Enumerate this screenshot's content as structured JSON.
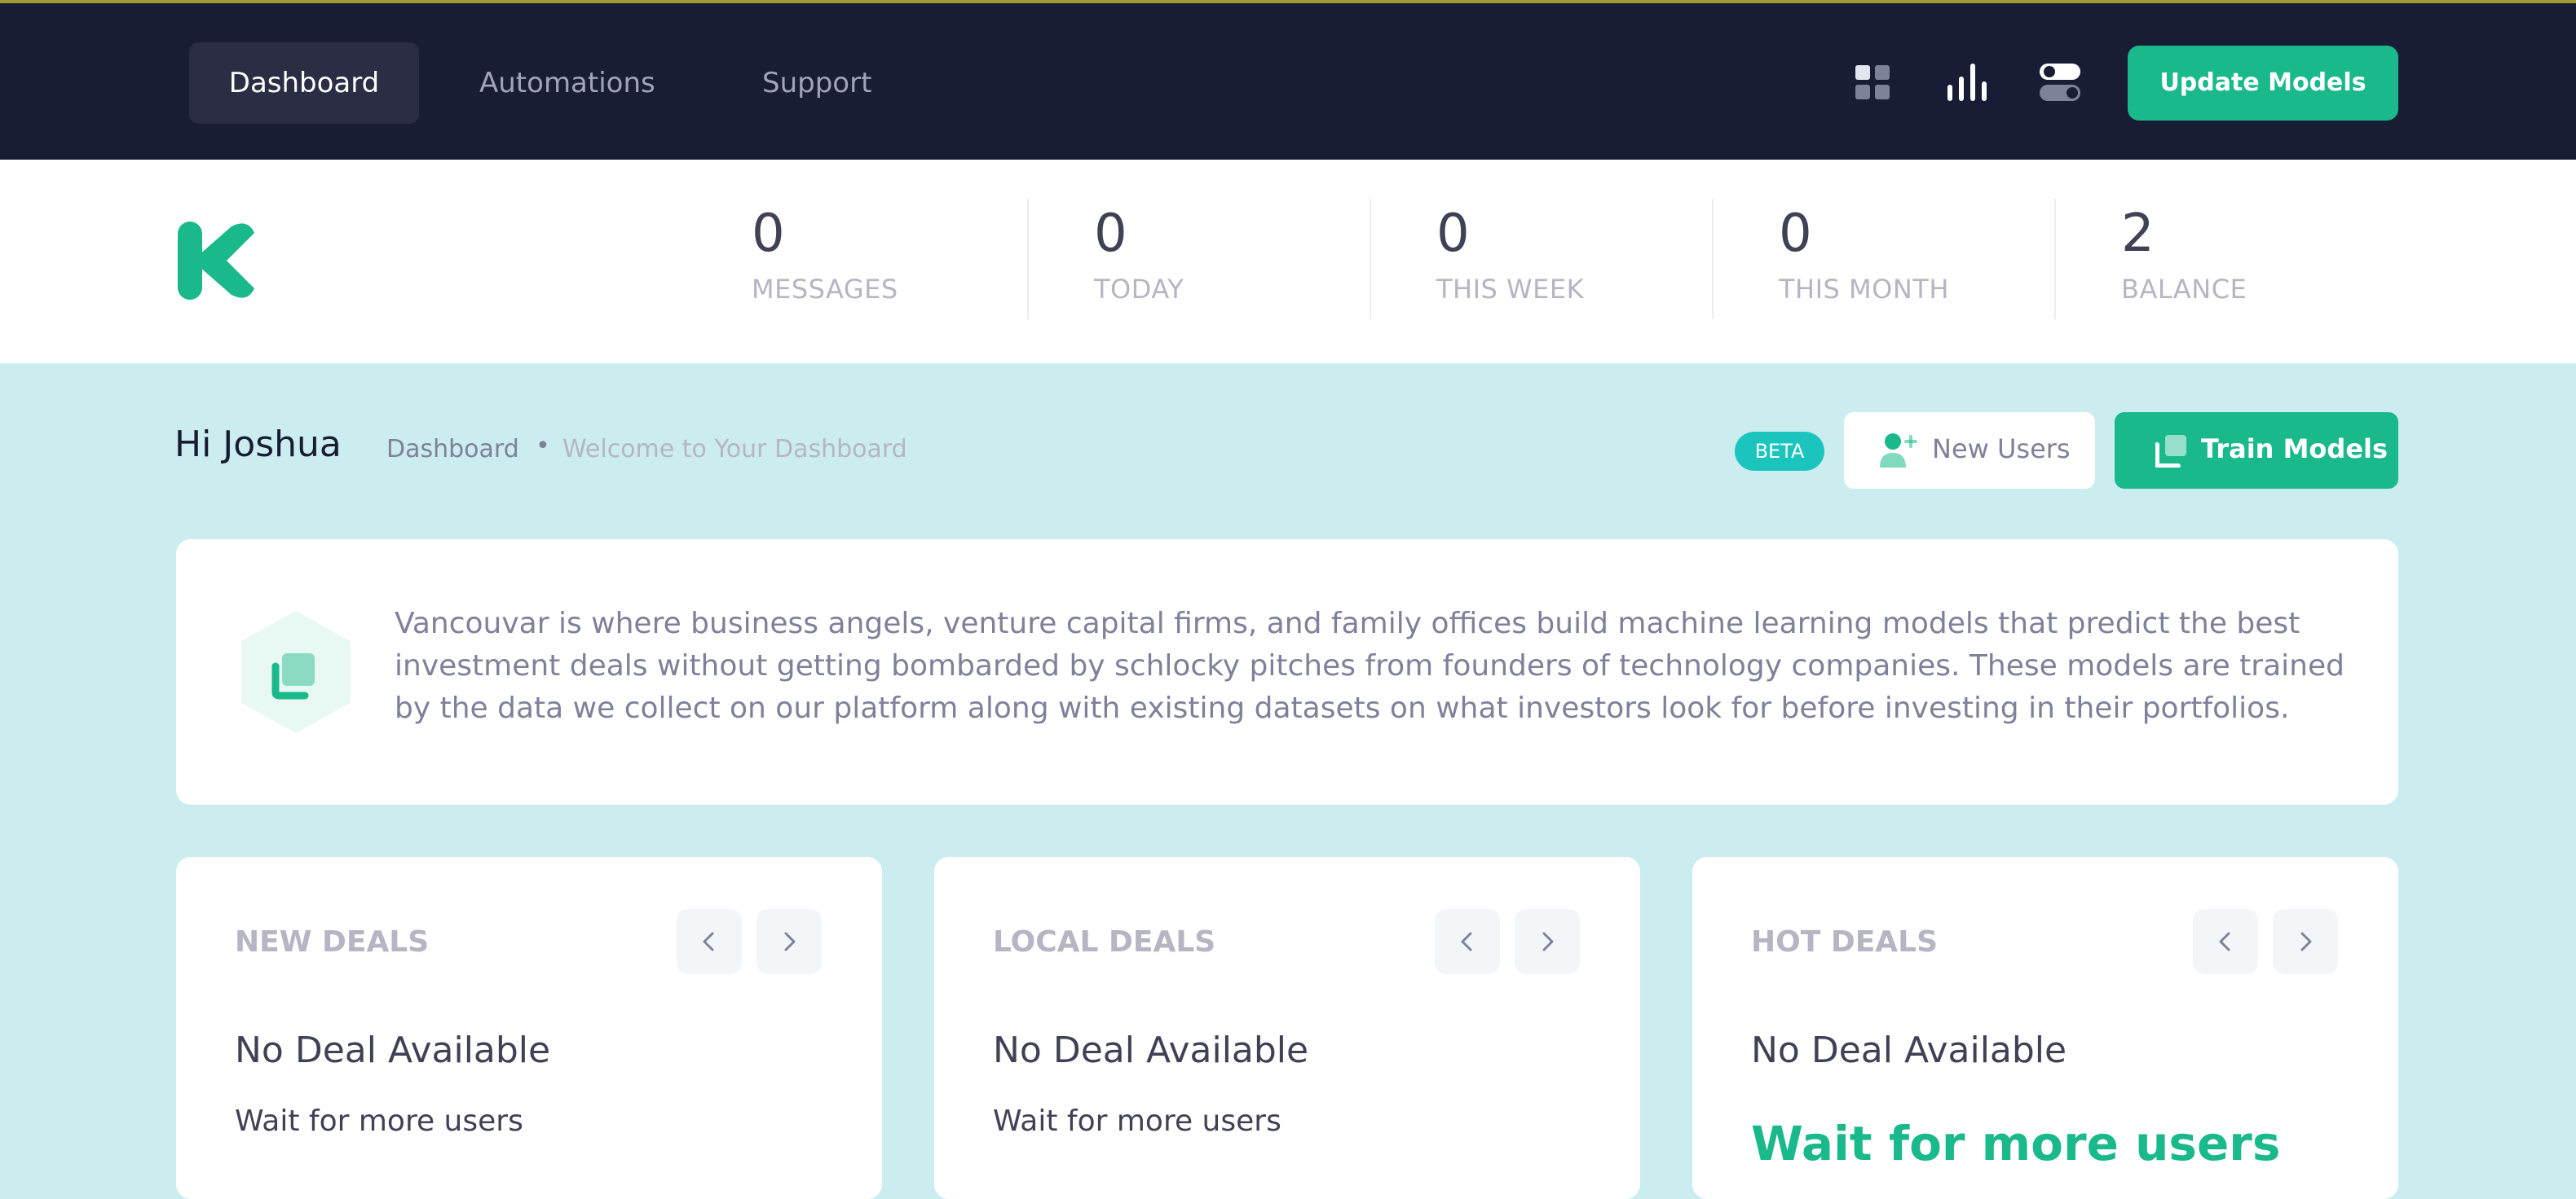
{
  "nav": {
    "links": [
      "Dashboard",
      "Automations",
      "Support"
    ],
    "icons": [
      "grid-icon",
      "bar-chart-icon",
      "toggle-icon"
    ],
    "update_button": "Update Models"
  },
  "stats": [
    {
      "value": "0",
      "label": "MESSAGES"
    },
    {
      "value": "0",
      "label": "TODAY"
    },
    {
      "value": "0",
      "label": "THIS WEEK"
    },
    {
      "value": "0",
      "label": "THIS MONTH"
    },
    {
      "value": "2",
      "label": "BALANCE"
    }
  ],
  "subheader": {
    "greeting": "Hi Joshua",
    "breadcrumb": {
      "root": "Dashboard",
      "separator": "•",
      "current": "Welcome to Your Dashboard"
    },
    "beta_badge": "BETA",
    "new_users_button": "New Users",
    "train_models_button": "Train Models"
  },
  "info": {
    "text": "Vancouvar is where business angels, venture capital firms, and family offices build machine learning models that predict the best investment deals without getting bombarded by schlocky pitches from founders of technology companies. These models are trained by the data we collect on our platform along with existing datasets on what investors look for before investing in their portfolios."
  },
  "deals": [
    {
      "title": "NEW DEALS",
      "heading": "No Deal Available",
      "subtext": "Wait for more users"
    },
    {
      "title": "LOCAL DEALS",
      "heading": "No Deal Available",
      "subtext": "Wait for more users"
    },
    {
      "title": "HOT DEALS",
      "heading": "No Deal Available",
      "subtext": "Wait for more users"
    }
  ],
  "colors": {
    "nav_background": "#191c35",
    "accent_green": "#1ab98c",
    "page_background": "#ccedf0",
    "beta_badge": "#1bc5bd"
  }
}
